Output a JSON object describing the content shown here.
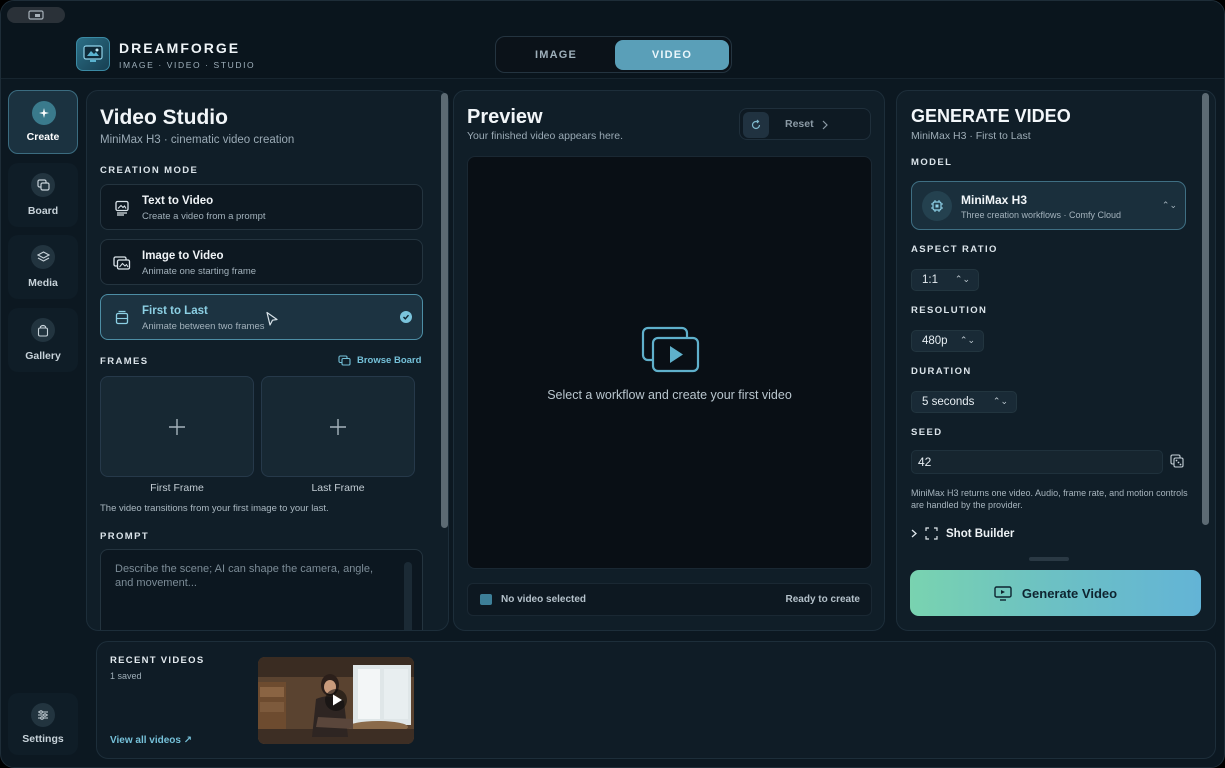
{
  "brand": {
    "name": "DREAMFORGE",
    "tagline": "IMAGE · VIDEO · STUDIO"
  },
  "mode_toggle": {
    "image": "IMAGE",
    "video": "VIDEO",
    "selected": "VIDEO"
  },
  "sidebar": {
    "items": [
      {
        "label": "Create",
        "icon": "sparkle-icon",
        "active": true
      },
      {
        "label": "Board",
        "icon": "board-icon",
        "active": false
      },
      {
        "label": "Media",
        "icon": "layers-icon",
        "active": false
      },
      {
        "label": "Gallery",
        "icon": "gallery-icon",
        "active": false
      }
    ],
    "settings": {
      "label": "Settings",
      "icon": "sliders-icon"
    }
  },
  "studio": {
    "title": "Video Studio",
    "subtitle": "MiniMax H3 · cinematic video creation",
    "creation_mode_label": "CREATION MODE",
    "modes": [
      {
        "title": "Text to Video",
        "desc": "Create a video from a prompt",
        "icon": "text-image-icon",
        "selected": false
      },
      {
        "title": "Image to Video",
        "desc": "Animate one starting frame",
        "icon": "images-icon",
        "selected": false
      },
      {
        "title": "First to Last",
        "desc": "Animate between two frames",
        "icon": "frames-icon",
        "selected": true
      }
    ],
    "frames_label": "FRAMES",
    "browse_board": "Browse Board",
    "first_frame": "First Frame",
    "last_frame": "Last Frame",
    "frames_note": "The video transitions from your first image to your last.",
    "prompt_label": "PROMPT",
    "prompt_placeholder": "Describe the scene; AI can shape the camera, angle, and movement..."
  },
  "preview": {
    "title": "Preview",
    "subtitle": "Your finished video appears here.",
    "reset": "Reset",
    "empty_message": "Select a workflow and create your first video",
    "status_left": "No video selected",
    "status_right": "Ready to create"
  },
  "generate": {
    "title": "GENERATE VIDEO",
    "subtitle": "MiniMax H3 · First to Last",
    "model_label": "MODEL",
    "model_name": "MiniMax H3",
    "model_desc": "Three creation workflows · Comfy Cloud",
    "aspect_label": "ASPECT RATIO",
    "aspect_value": "1:1",
    "resolution_label": "RESOLUTION",
    "resolution_value": "480p",
    "duration_label": "DURATION",
    "duration_value": "5 seconds",
    "seed_label": "SEED",
    "seed_value": "42",
    "note": "MiniMax H3 returns one video. Audio, frame rate, and motion controls are handled by the provider.",
    "shot_builder": "Shot Builder",
    "button": "Generate Video"
  },
  "recent": {
    "title": "RECENT VIDEOS",
    "count": "1 saved",
    "view_all": "View all videos ↗"
  },
  "colors": {
    "accent": "#5a9fb8",
    "accent_light": "#74c0d8",
    "background": "#0c1821",
    "generate_gradient_start": "#79d3b0",
    "generate_gradient_end": "#63b4d6"
  }
}
